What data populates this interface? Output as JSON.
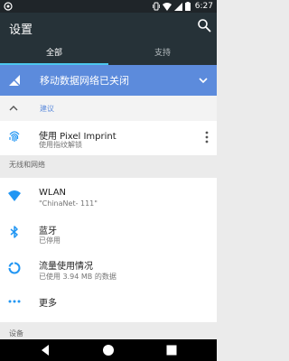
{
  "status_bar": {
    "time": "6:27"
  },
  "app_bar": {
    "title": "设置"
  },
  "tabs": [
    {
      "label": "全部"
    },
    {
      "label": "支持"
    }
  ],
  "banner": {
    "text": "移动数据网络已关闭"
  },
  "suggestions": {
    "label": "建议",
    "item": {
      "title": "使用 Pixel Imprint",
      "subtitle": "使用指纹解锁"
    }
  },
  "sections": {
    "wireless": "无线和网络",
    "device": "设备"
  },
  "wireless_items": [
    {
      "title": "WLAN",
      "subtitle": "\"ChinaNet- 111\"",
      "icon": "wifi-icon"
    },
    {
      "title": "蓝牙",
      "subtitle": "已停用",
      "icon": "bluetooth-icon"
    },
    {
      "title": "流量使用情况",
      "subtitle": "已使用 3.94 MB 的数据",
      "icon": "data-usage-icon"
    },
    {
      "title": "更多",
      "icon": "more-horizontal-icon"
    }
  ],
  "colors": {
    "app_bar": "#263238",
    "banner": "#5c8bdc",
    "accent": "#4dc7ee",
    "icon_blue": "#2196f3"
  }
}
